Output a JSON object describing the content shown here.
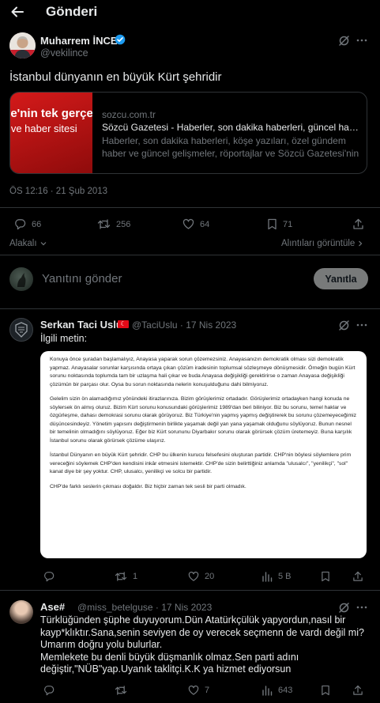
{
  "header": {
    "title": "Gönderi"
  },
  "tweet": {
    "author_name": "Muharrem İNCE",
    "author_handle": "@vekilince",
    "text": "İstanbul dünyanın en büyük Kürt şehridir",
    "card": {
      "thumb_line1": "ye'nin tek gerçek",
      "thumb_line2": "e ve haber sitesi",
      "domain": "sozcu.com.tr",
      "title": "Sözcü Gazetesi - Haberler, son dakika haberleri, güncel haberler",
      "description": "Haberler, son dakika haberleri, köşe yazıları, özel gündem haber ve güncel gelişmeler, röportajlar ve Sözcü Gazetesi'nin tüm haberleri"
    },
    "timestamp": "ÖS 12:16 · 21 Şub 2013",
    "stats": {
      "replies": "66",
      "reposts": "256",
      "likes": "64",
      "bookmarks": "71"
    },
    "related_label": "Alakalı",
    "quotes_label": "Alıntıları görüntüle"
  },
  "reply_box": {
    "placeholder": "Yanıtını gönder",
    "button_label": "Yanıtla"
  },
  "comments": [
    {
      "name": "Serkan Taci Uslu",
      "flag": "☾",
      "meta": "@TaciUslu · 17 Nis 2023",
      "text": "İlgili metin:",
      "image_paragraphs": [
        "Konuya önce şuradan başlamalıyız, Anayasa yaparak sorun çözemezsiniz. Anayasanızın demokratik olması sizi demokratik yapmaz. Anayasalar sorunlar karşısında ortaya çıkan çözüm iradesinin toplumsal sözleşmeye dönüşmesidir. Örneğin bugün Kürt sorunu noktasında toplumda tam bir uzlaşma hali çıkar ve buda Anayasa değişikliği gerektirirse o zaman Anayasa değişikliği çözümün bir parçası olur. Oysa bu sorun noktasında nelerin konuşulduğunu dahi bilmiyoruz.",
        "Gelelim sizin ön alamadığımız yönündeki itirazlarınıza. Bizim görüşlerimiz ortadadır. Görüşlerimiz ortadayken hangi konuda ne söylersek ön almış oluruz. Bizim Kürt sorunu konusundaki görüşlerimiz 1989'dan beri biliniyor. Biz bu sorunu, temel haklar ve özgürleşme, dahası demokrasi sorunu olarak görüyoruz. Biz Türkiye'nin yapmış yapmış değiştirerek bu sorunu çözemeyeceğimiz düşüncesindeyiz. Yönetim yapısını değiştirmenin birlikte yaşamak değil yan yana yaşamak olduğunu söylüyoruz. Bunun nesnel bir temelinin olmadığını söylüyoruz. Eğer biz Kürt sorununu Diyarbakır sorunu olarak görürsek çözüm üretemeyiz. Buna karşılık İstanbul sorunu olarak görürsek çözüme ulaşırız.",
        "İstanbul Dünyanın en büyük Kürt şehridir. CHP bu ülkenin kurucu felsefesini oluşturan partidir. CHP'nin böylesi söylemlere prim vereceğini söylemek CHP'den kendisini inkâr etmesini istemektir. CHP'de sizin belirttiğiniz anlamda \"ulusalcı\", \"yenilikçi\", \"sol\" kanat diye bir şey yoktur. CHP, ulusalcı, yenilikçi ve solcu bir partidir.",
        "CHP'de farklı seslerin çıkması doğaldır. Biz hiçbir zaman tek sesli bir parti olmadık."
      ],
      "stats": {
        "replies": "",
        "reposts": "1",
        "likes": "20",
        "views": "5 B"
      }
    },
    {
      "name": "Ase#",
      "meta": "@miss_betelguse · 17 Nis 2023",
      "lines": [
        "Türklüğünden şüphe duyuyorum.Dün Atatürkçülük yapyordun,nasıl bir kayp*klıktır.Sana,senin seviyen de oy verecek seçmenn de vardı değil mi?",
        "Umarım doğru yolu bulurlar.",
        "Memlekete bu denli büyük düşmanlık olmaz.Sen parti adını değiştir,\"NÜB\"yap.Uyanık taklitçi.K.K ya hizmet ediyorsun"
      ],
      "stats": {
        "replies": "",
        "reposts": "",
        "likes": "7",
        "views": "643"
      }
    }
  ]
}
